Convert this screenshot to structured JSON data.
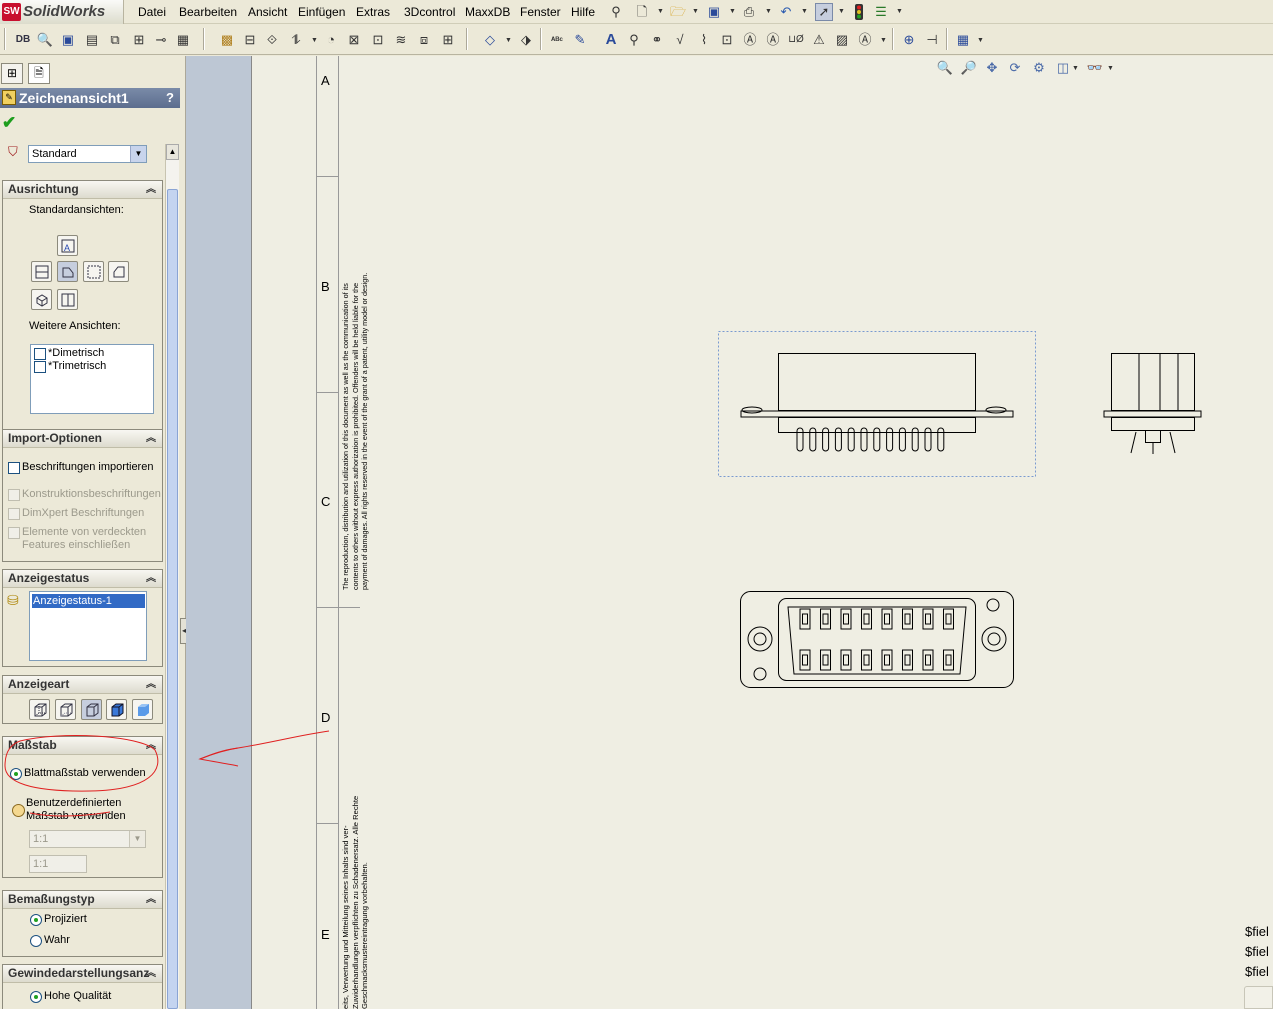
{
  "app": {
    "logo_badge": "SW",
    "name": "SolidWorks"
  },
  "menu": [
    "Datei",
    "Bearbeiten",
    "Ansicht",
    "Einfügen",
    "Extras",
    "3Dcontrol",
    "MaxxDB",
    "Fenster",
    "Hilfe"
  ],
  "toolbar2": {
    "first_label": "DB"
  },
  "property_manager": {
    "title": "Zeichenansicht1",
    "help": "?",
    "style_select": "Standard",
    "ausrichtung": {
      "header": "Ausrichtung",
      "standard_views_label": "Standardansichten:",
      "more_views_label": "Weitere Ansichten:",
      "more_views": [
        "*Dimetrisch",
        "*Trimetrisch"
      ]
    },
    "import": {
      "header": "Import-Optionen",
      "options": [
        "Beschriftungen importieren",
        "Konstruktionsbeschriftungen",
        "DimXpert Beschriftungen"
      ],
      "option_hidden_line1": "Elemente von verdeckten",
      "option_hidden_line2": "Features einschließen"
    },
    "display_state": {
      "header": "Anzeigestatus",
      "selected": "Anzeigestatus-1"
    },
    "display_style": {
      "header": "Anzeigeart"
    },
    "scale": {
      "header": "Maßstab",
      "use_sheet_scale": "Blattmaßstab verwenden",
      "custom_line1": "Benutzerdefinierten",
      "custom_line2": "Maßstab verwenden",
      "select_value": "1:1",
      "input_value": "1:1"
    },
    "dim_type": {
      "header": "Bemaßungstyp",
      "options": [
        "Projiziert",
        "Wahr"
      ]
    },
    "thread": {
      "header": "Gewindedarstellungsanz",
      "option": "Hohe Qualität"
    }
  },
  "sheet": {
    "zones": [
      "A",
      "B",
      "C",
      "D",
      "E"
    ],
    "notice_en": [
      "The reproduction, distribution and utilization of this document as well as the communication of its",
      "contents to others without express authorization is prohibited. Offenders will be held liable for the",
      "payment of damages. All rights reserved in the event of the grant of a patent, utility model or design."
    ],
    "notice_de": [
      "eits, Verwertung und Mitteilung seines Inhalts sind ver-",
      "Zuwiderhandlungen verpflichten zu Schadenersatz. Alle Rechte",
      "Geschmacksmustereintragung vorbehalten."
    ],
    "fields": [
      "$fiel",
      "$fiel",
      "$fiel"
    ]
  },
  "colors": {
    "annotation": "#e02020",
    "title_bar": "#6b7c9b",
    "check": "#1e9e1e"
  }
}
